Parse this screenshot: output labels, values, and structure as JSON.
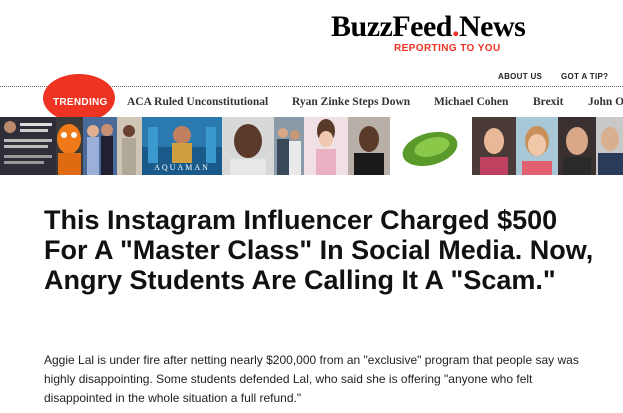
{
  "brand": {
    "name": "BuzzFeed",
    "dot": ".",
    "suffix": "News",
    "tagline": "REPORTING TO YOU"
  },
  "colors": {
    "accent": "#ee3322",
    "text": "#111111"
  },
  "utility_nav": {
    "about": "ABOUT US",
    "tip": "GOT A TIP?"
  },
  "trending": {
    "label": "TRENDING",
    "items": [
      "ACA Ruled Unconstitutional",
      "Ryan Zinke Steps Down",
      "Michael Cohen",
      "Brexit",
      "John O"
    ]
  },
  "thumbnails": {
    "aquaman_caption": "AQUAMAN",
    "items": [
      "screenshot-thumbnail",
      "gritty-mascot-thumbnail",
      "celebrity-couple-thumbnail",
      "person-thumbnail",
      "aquaman-poster-thumbnail",
      "mugshot-thumbnail",
      "group-photo-thumbnail",
      "ariana-grande-thumbnail",
      "kanye-west-thumbnail",
      "lettuce-thumbnail",
      "woman-portrait-thumbnail",
      "selfie-thumbnail",
      "woman-smiling-thumbnail",
      "man-portrait-thumbnail"
    ]
  },
  "article": {
    "headline": "This Instagram Influencer Charged $500 For A \"Master Class\" In Social Media. Now, Angry Students Are Calling It A \"Scam.\"",
    "dek": "Aggie Lal is under fire after netting nearly $200,000 from an \"exclusive\" program that people say was highly disappointing. Some students defended Lal, who said she is offering \"anyone who felt disappointed in the whole situation a full refund.\""
  }
}
